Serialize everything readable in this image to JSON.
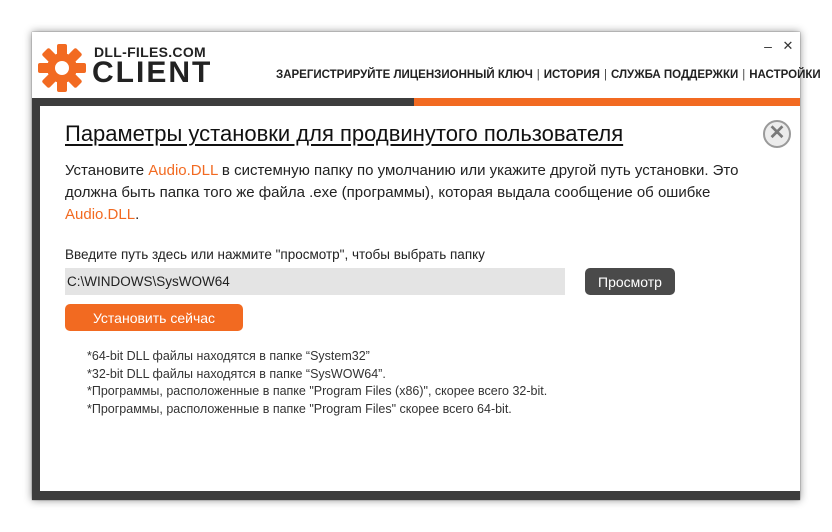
{
  "colors": {
    "accent": "#f26a21",
    "dark_bg": "#3d3d3d",
    "browse_button": "#4a4a4a",
    "input_bg": "#e4e4e4"
  },
  "window": {
    "brand_top": "DLL-FILES.COM",
    "brand_main": "CLIENT",
    "minimize_glyph": "–",
    "close_glyph": "✕",
    "nav": [
      "ЗАРЕГИСТРИРУЙТЕ ЛИЦЕНЗИОННЫЙ КЛЮЧ",
      "ИСТОРИЯ",
      "СЛУЖБА ПОДДЕРЖКИ",
      "НАСТРОЙКИ"
    ],
    "nav_separator": "|"
  },
  "dialog": {
    "title": "Параметры установки для продвинутого пользователя",
    "close_glyph": "✕",
    "description": {
      "part1": "Установите ",
      "dll1": "Audio.DLL",
      "part2": " в системную папку по умолчанию или укажите другой путь установки. Это должна быть папка того же файла .exe (программы), которая выдала сообщение об ошибке ",
      "dll2": "Audio.DLL",
      "part3": "."
    },
    "path_label": "Введите путь здесь или нажмите \"просмотр\", чтобы выбрать папку",
    "path_value": "C:\\WINDOWS\\SysWOW64",
    "browse_label": "Просмотр",
    "install_label": "Установить сейчас",
    "notes": [
      "*64-bit DLL файлы находятся в папке “System32”",
      "*32-bit DLL файлы находятся в папке “SysWOW64”.",
      "*Программы, расположенные в папке \"Program Files (x86)\", скорее всего 32-bit.",
      "*Программы, расположенные в папке \"Program Files\" скорее всего 64-bit."
    ]
  }
}
